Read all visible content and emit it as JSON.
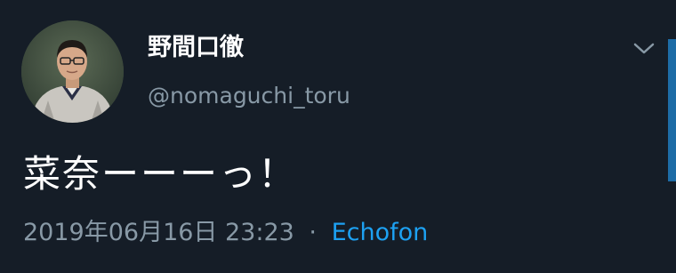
{
  "tweet": {
    "display_name": "野間口徹",
    "handle": "@nomaguchi_toru",
    "text": "菜奈ーーーっ！",
    "timestamp": "2019年06月16日 23:23",
    "separator": "·",
    "client": "Echofon"
  },
  "icons": {
    "avatar": "user-avatar",
    "menu": "chevron-down-icon"
  },
  "colors": {
    "background": "#151d27",
    "text_primary": "#ffffff",
    "text_secondary": "#8899a6",
    "link": "#1da1f2",
    "scrollbar": "#1d6ca6"
  }
}
